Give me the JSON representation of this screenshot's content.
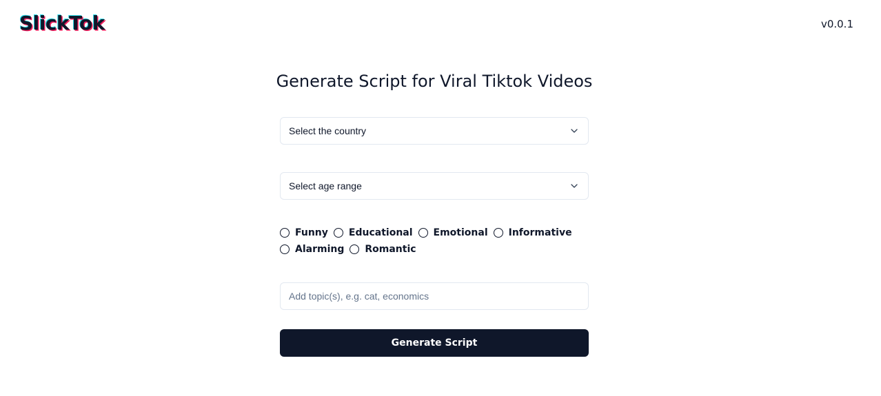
{
  "header": {
    "logo_text": "SlickTok",
    "version": "v0.0.1"
  },
  "main": {
    "title": "Generate Script for Viral Tiktok Videos",
    "country_select": {
      "value": "Select the country",
      "icon": "chevron-down-icon"
    },
    "age_select": {
      "value": "Select age range",
      "icon": "chevron-down-icon"
    },
    "tone_options": [
      {
        "label": "Funny",
        "selected": false
      },
      {
        "label": "Educational",
        "selected": false
      },
      {
        "label": "Emotional",
        "selected": false
      },
      {
        "label": "Informative",
        "selected": false
      },
      {
        "label": "Alarming",
        "selected": false
      },
      {
        "label": "Romantic",
        "selected": false
      }
    ],
    "topic_input": {
      "value": "",
      "placeholder": "Add topic(s), e.g. cat, economics"
    },
    "generate_button_label": "Generate Script"
  },
  "colors": {
    "primary": "#0f172a",
    "border": "#e2e8f0",
    "placeholder": "#64748b",
    "logo_shadow_pink": "#ef1c5b",
    "logo_shadow_cyan": "#25d7e3"
  }
}
